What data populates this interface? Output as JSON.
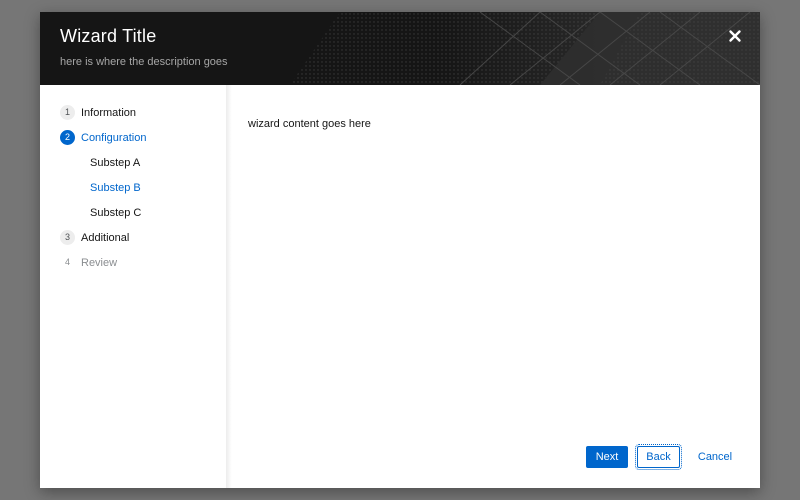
{
  "wizard": {
    "title": "Wizard Title",
    "description": "here is where the description goes",
    "close_icon": "close-icon"
  },
  "nav": {
    "steps": [
      {
        "number": "1",
        "label": "Information",
        "state": "default"
      },
      {
        "number": "2",
        "label": "Configuration",
        "state": "active",
        "substeps": [
          {
            "label": "Substep A",
            "state": "default"
          },
          {
            "label": "Substep B",
            "state": "active"
          },
          {
            "label": "Substep C",
            "state": "default"
          }
        ]
      },
      {
        "number": "3",
        "label": "Additional",
        "state": "default"
      },
      {
        "number": "4",
        "label": "Review",
        "state": "disabled"
      }
    ]
  },
  "main": {
    "content": "wizard content goes here"
  },
  "footer": {
    "next_label": "Next",
    "back_label": "Back",
    "cancel_label": "Cancel"
  },
  "colors": {
    "accent": "#0066cc",
    "header_bg": "#151515",
    "backdrop": "#767676"
  }
}
